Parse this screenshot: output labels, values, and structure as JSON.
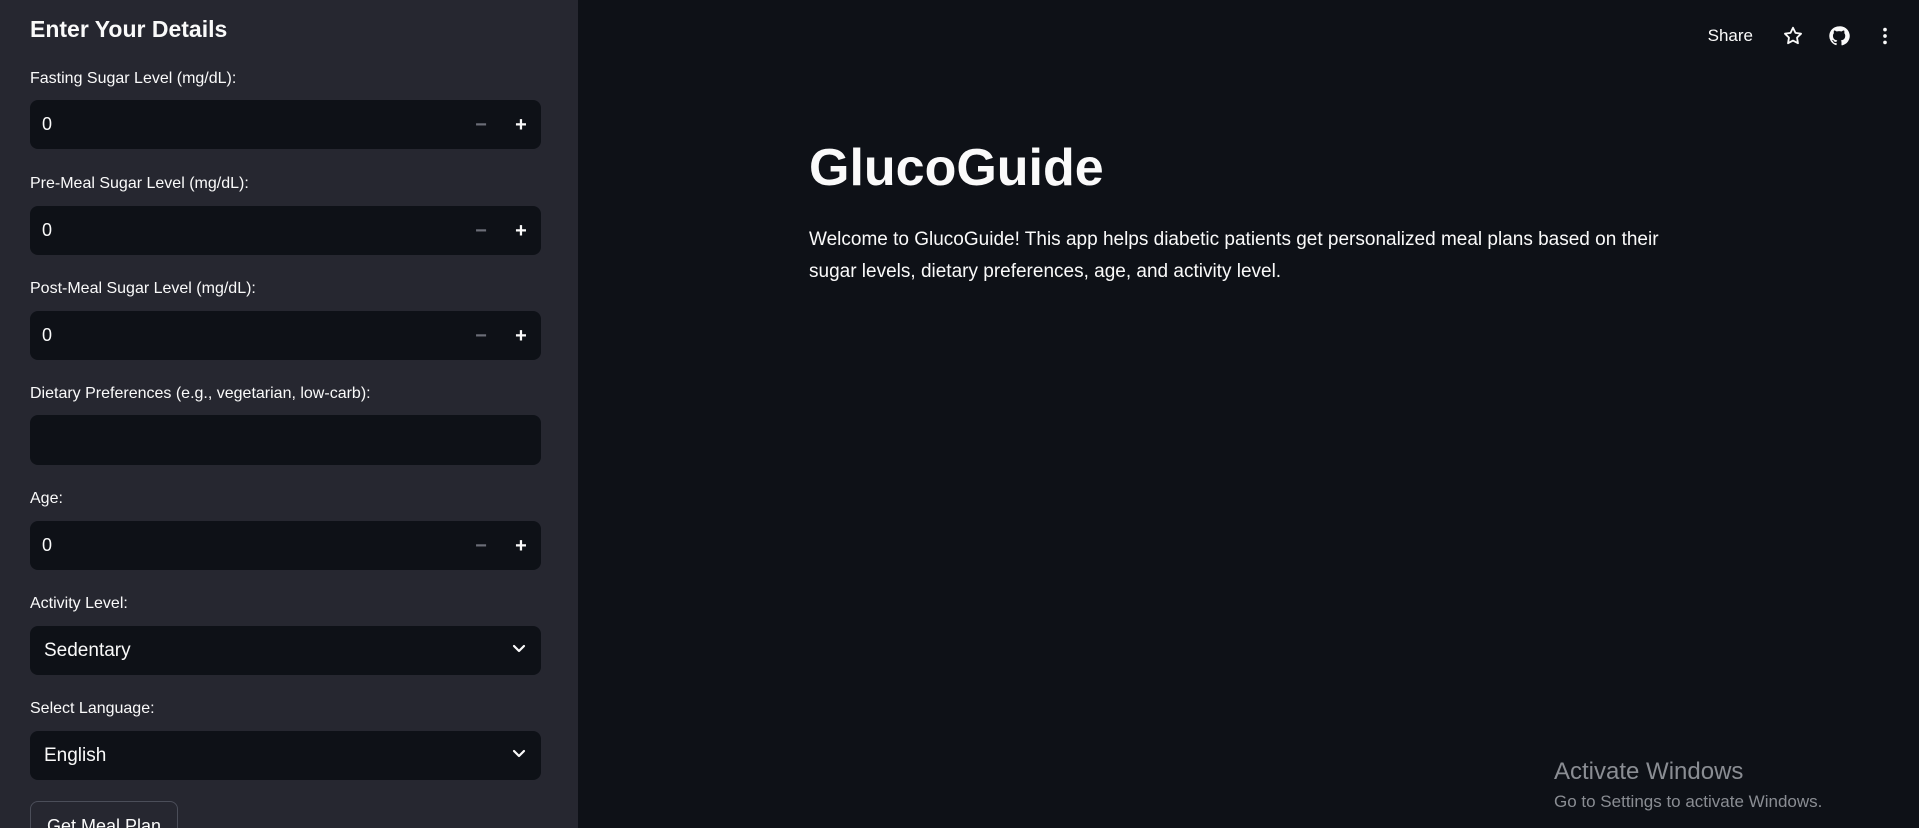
{
  "sidebar": {
    "title": "Enter Your Details",
    "fasting": {
      "label": "Fasting Sugar Level (mg/dL):",
      "value": "0"
    },
    "premeal": {
      "label": "Pre-Meal Sugar Level (mg/dL):",
      "value": "0"
    },
    "postmeal": {
      "label": "Post-Meal Sugar Level (mg/dL):",
      "value": "0"
    },
    "dietary": {
      "label": "Dietary Preferences (e.g., vegetarian, low-carb):",
      "value": ""
    },
    "age": {
      "label": "Age:",
      "value": "0"
    },
    "activity": {
      "label": "Activity Level:",
      "value": "Sedentary"
    },
    "language": {
      "label": "Select Language:",
      "value": "English"
    },
    "submit_label": "Get Meal Plan",
    "stepper": {
      "minus": "−",
      "plus": "+"
    }
  },
  "toolbar": {
    "share_label": "Share",
    "icons": [
      "star-icon",
      "github-icon",
      "more-vertical-icon"
    ]
  },
  "main": {
    "title": "GlucoGuide",
    "description": "Welcome to GlucoGuide! This app helps diabetic patients get personalized meal plans based on their sugar levels, dietary preferences, age, and activity level."
  },
  "watermark": {
    "line1": "Activate Windows",
    "line2": "Go to Settings to activate Windows."
  },
  "colors": {
    "background": "#0e1117",
    "sidebar": "#262730",
    "text": "#fafafa"
  }
}
